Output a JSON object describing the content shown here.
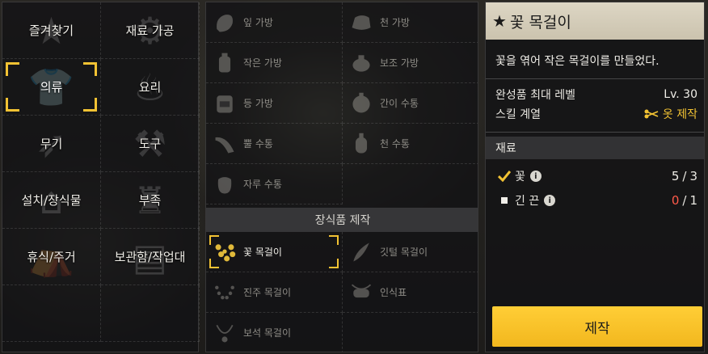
{
  "categories": [
    {
      "label": "즐겨찾기",
      "icon": "star-icon",
      "selected": false
    },
    {
      "label": "재료 가공",
      "icon": "grinder-icon",
      "selected": false
    },
    {
      "label": "의류",
      "icon": "shirt-icon",
      "selected": true
    },
    {
      "label": "요리",
      "icon": "pot-icon",
      "selected": false
    },
    {
      "label": "무기",
      "icon": "spear-icon",
      "selected": false
    },
    {
      "label": "도구",
      "icon": "shovel-icon",
      "selected": false
    },
    {
      "label": "설치/장식물",
      "icon": "easel-icon",
      "selected": false
    },
    {
      "label": "부족",
      "icon": "totem-icon",
      "selected": false
    },
    {
      "label": "휴식/주거",
      "icon": "tent-icon",
      "selected": false
    },
    {
      "label": "보관함/작업대",
      "icon": "workbench-icon",
      "selected": false
    },
    {
      "label": "",
      "icon": "",
      "selected": false
    },
    {
      "label": "",
      "icon": "",
      "selected": false
    }
  ],
  "items": [
    {
      "name": "잎 가방",
      "icon": "leaf-bag-icon"
    },
    {
      "name": "천 가방",
      "icon": "cloth-bag-icon"
    },
    {
      "name": "작은 가방",
      "icon": "small-bag-icon"
    },
    {
      "name": "보조 가방",
      "icon": "side-bag-icon"
    },
    {
      "name": "등 가방",
      "icon": "backpack-icon"
    },
    {
      "name": "간이 수통",
      "icon": "simple-canteen-icon"
    },
    {
      "name": "뿔 수통",
      "icon": "horn-canteen-icon"
    },
    {
      "name": "천 수통",
      "icon": "cloth-canteen-icon"
    },
    {
      "name": "자루 수통",
      "icon": "sack-canteen-icon"
    }
  ],
  "section_title": "장식품 제작",
  "accessories": [
    {
      "name": "꽃 목걸이",
      "icon": "flower-necklace-icon",
      "active": true
    },
    {
      "name": "깃털 목걸이",
      "icon": "feather-necklace-icon",
      "active": false
    },
    {
      "name": "진주 목걸이",
      "icon": "pearl-necklace-icon",
      "active": false
    },
    {
      "name": "인식표",
      "icon": "dogtag-icon",
      "active": false
    },
    {
      "name": "보석 목걸이",
      "icon": "gem-necklace-icon",
      "active": false
    }
  ],
  "detail": {
    "star": "★",
    "title": "꽃 목걸이",
    "description": "꽃을 엮어 작은 목걸이를 만들었다.",
    "max_level_label": "완성품 최대 레벨",
    "max_level_value": "Lv. 30",
    "skill_label": "스킬 계열",
    "skill_value": "옷 제작",
    "materials_header": "재료",
    "materials": [
      {
        "name": "꽃",
        "have": "5",
        "sep": "/",
        "need": "3",
        "ok": true
      },
      {
        "name": "긴 끈",
        "have": "0",
        "sep": "/",
        "need": "1",
        "ok": false
      }
    ],
    "craft_label": "제작"
  },
  "colors": {
    "accent": "#f2c233",
    "button": "#ffc72c",
    "insufficient": "#ff5a4a"
  }
}
